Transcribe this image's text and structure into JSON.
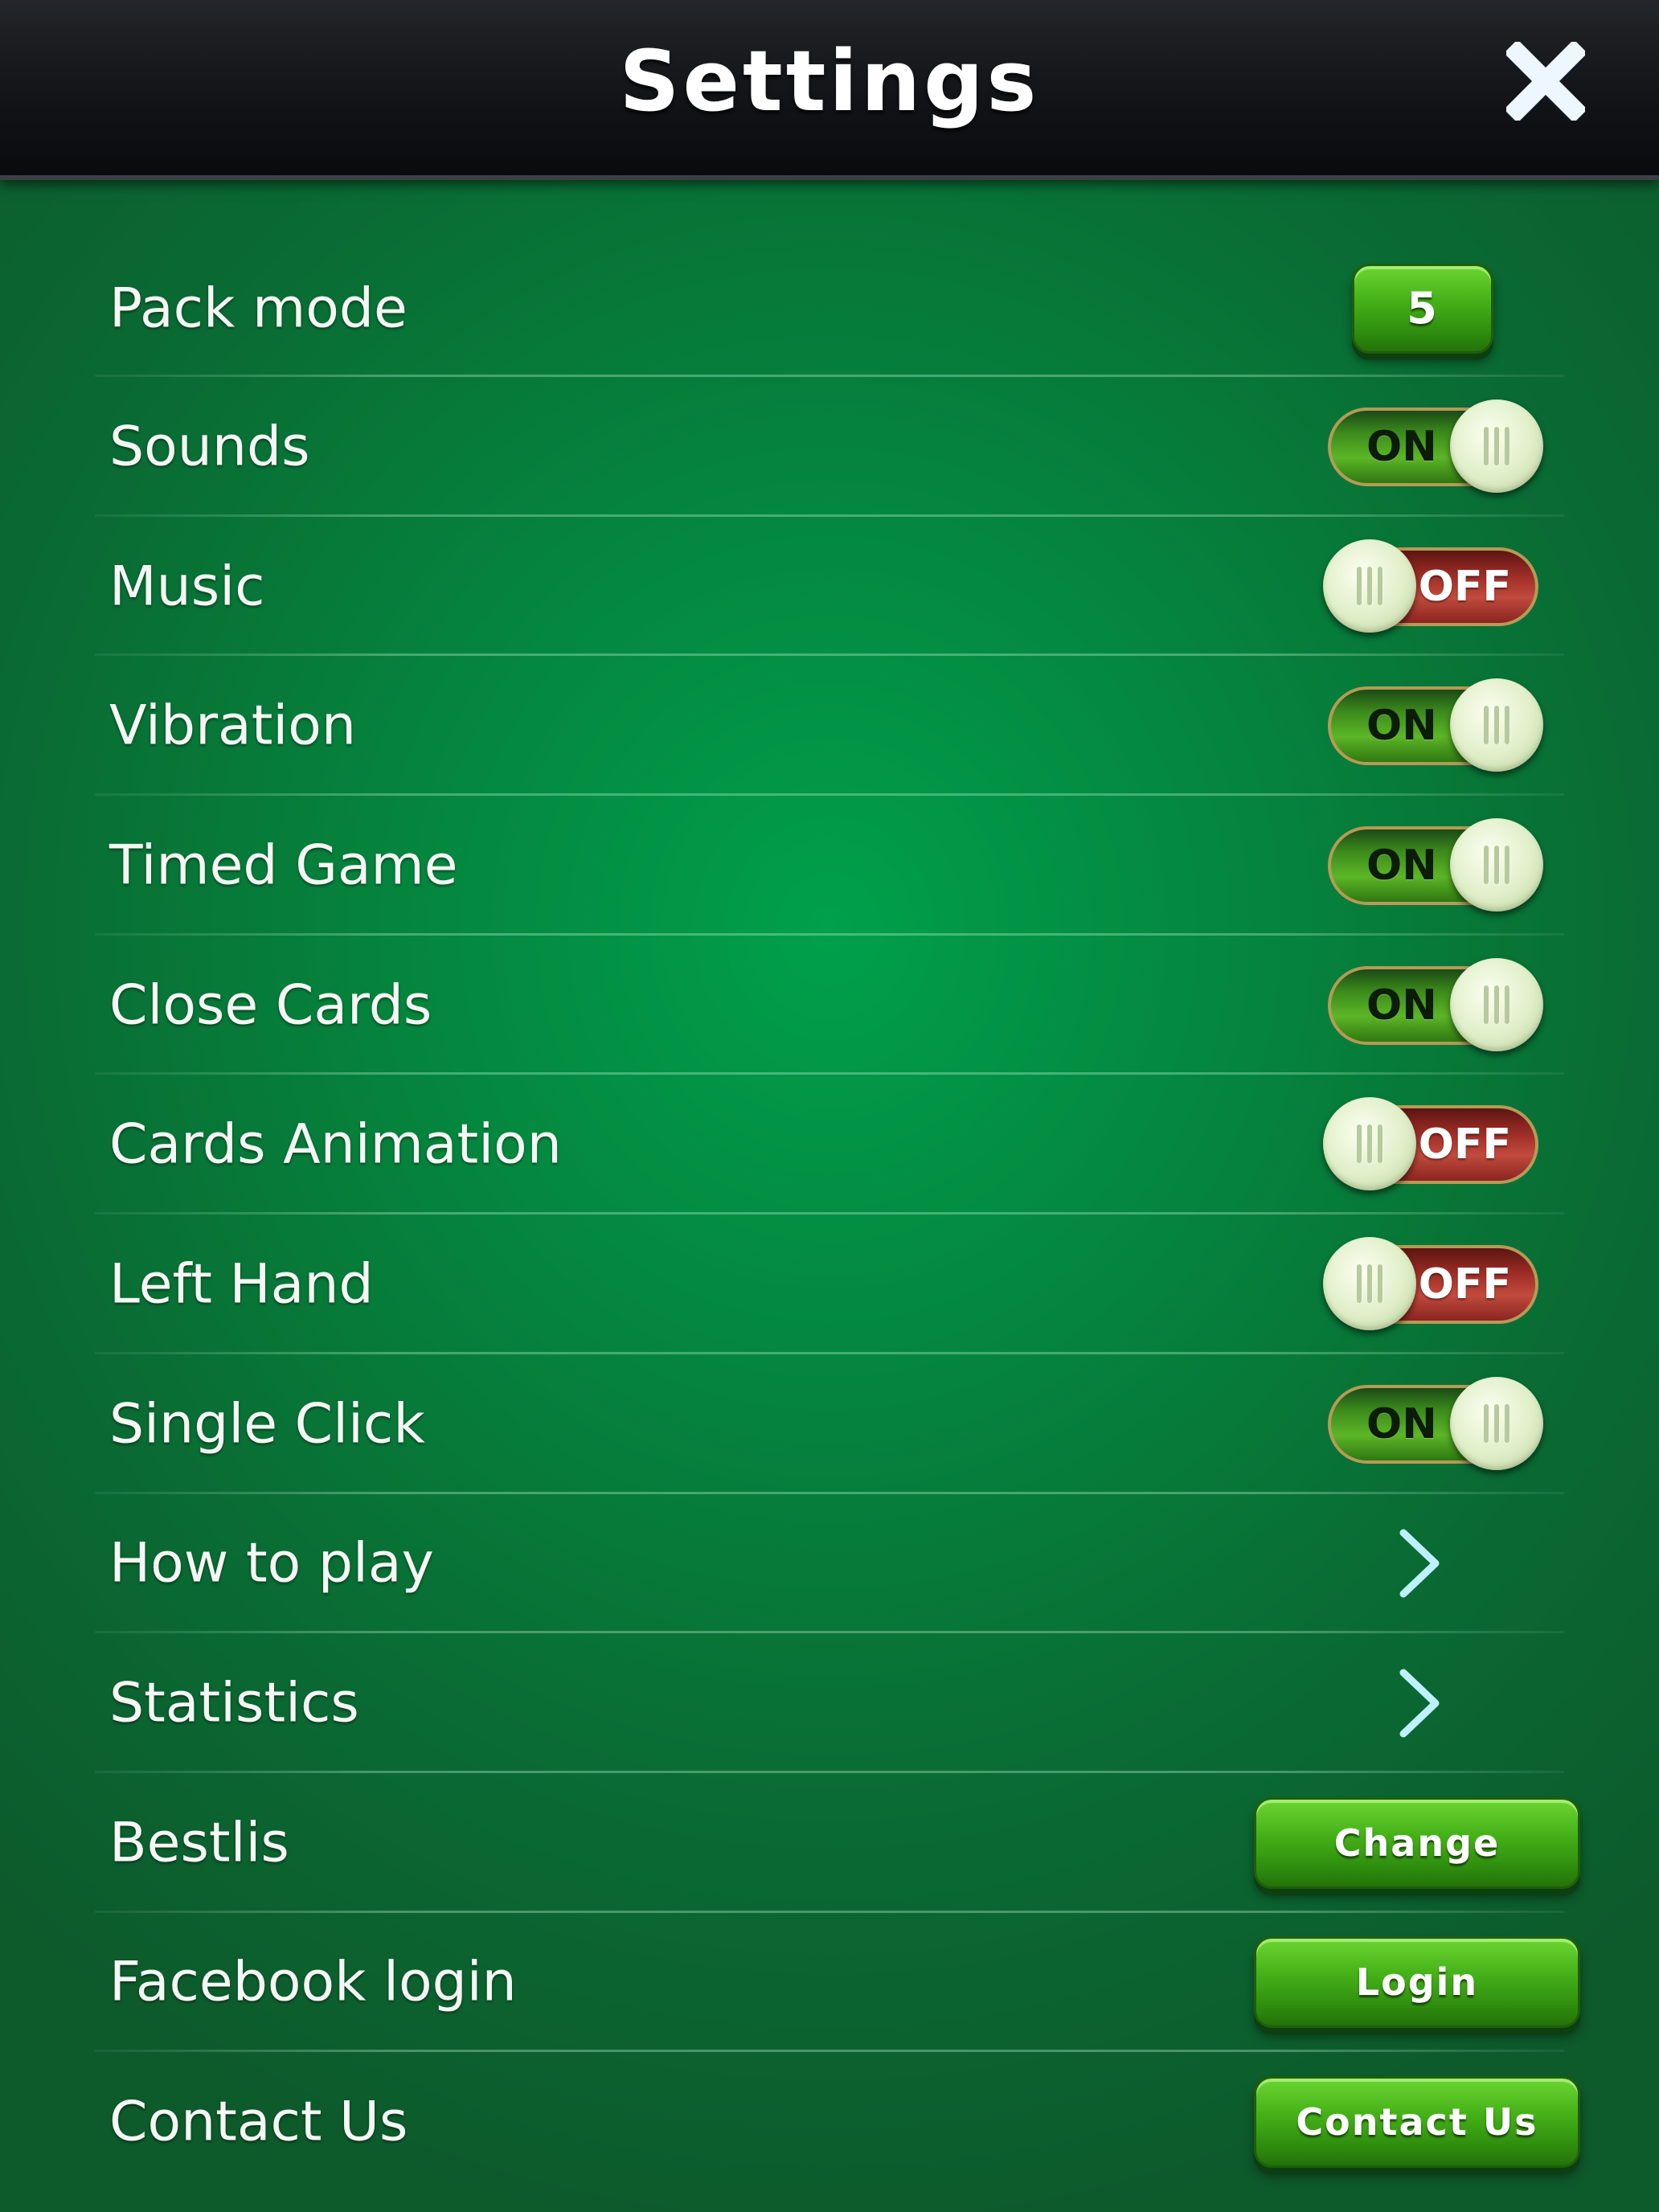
{
  "header": {
    "title": "Settings",
    "close_icon": "close-icon"
  },
  "colors": {
    "felt": "#05823c",
    "button_green": "#46b219",
    "toggle_on": "#5cb626",
    "toggle_off": "#c14a3d"
  },
  "settings": {
    "pack_mode": {
      "label": "Pack mode",
      "value": "5"
    },
    "sounds": {
      "label": "Sounds",
      "state": "ON"
    },
    "music": {
      "label": "Music",
      "state": "OFF"
    },
    "vibration": {
      "label": "Vibration",
      "state": "ON"
    },
    "timed_game": {
      "label": "Timed Game",
      "state": "ON"
    },
    "close_cards": {
      "label": "Close Cards",
      "state": "ON"
    },
    "cards_animation": {
      "label": "Cards Animation",
      "state": "OFF"
    },
    "left_hand": {
      "label": "Left Hand",
      "state": "OFF"
    },
    "single_click": {
      "label": "Single Click",
      "state": "ON"
    },
    "how_to_play": {
      "label": "How to play",
      "icon": "chevron-right-icon"
    },
    "statistics": {
      "label": "Statistics",
      "icon": "chevron-right-icon"
    },
    "bestlis": {
      "label": "Bestlis",
      "button": "Change"
    },
    "facebook_login": {
      "label": "Facebook login",
      "button": "Login"
    },
    "contact_us": {
      "label": "Contact Us",
      "button": "Contact Us"
    }
  }
}
